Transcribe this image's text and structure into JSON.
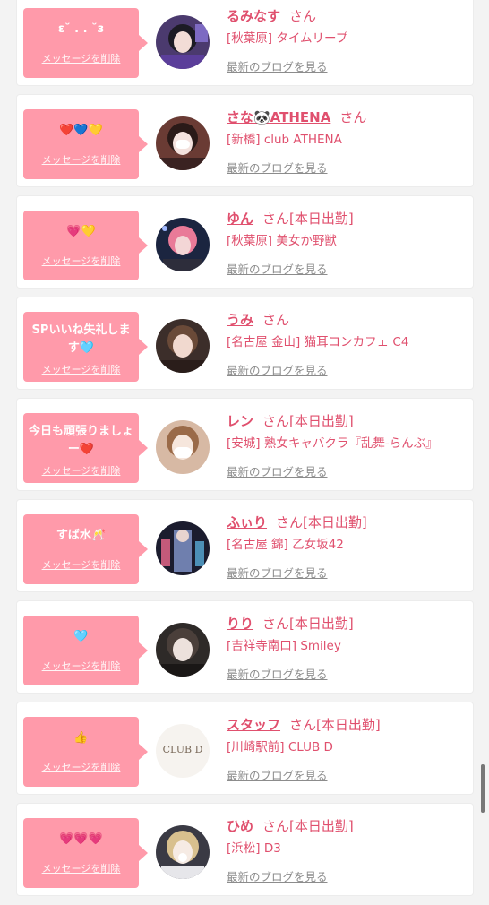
{
  "delete_label": "メッセージを削除",
  "blog_label": "最新のブログを見る",
  "san_label": "さん",
  "messages": [
    {
      "text": "ε˘ . . ˘з",
      "name": "るみなす",
      "suffix": "さん",
      "shop": "[秋葉原] タイムリープ",
      "two_line": false,
      "avatar_icon": "dark-hair-girl-photo"
    },
    {
      "text": "❤️💙💛",
      "name": "さな🐼ATHENA",
      "suffix": "さん",
      "shop": "[新橋] club ATHENA",
      "two_line": false,
      "avatar_icon": "costume-girl-photo"
    },
    {
      "text": "💗💛",
      "name": "ゆん",
      "suffix": "さん[本日出勤]",
      "shop": "[秋葉原] 美女か野獣",
      "two_line": false,
      "avatar_icon": "pink-hair-girl-photo"
    },
    {
      "text": "SPいいね失礼します🩵",
      "name": "うみ",
      "suffix": "さん",
      "shop": "[名古屋 金山] 猫耳コンカフェ C4",
      "two_line": true,
      "avatar_icon": "brown-hair-girl-photo"
    },
    {
      "text": "今日も頑張りましょー❤️",
      "name": "レン",
      "suffix": "さん[本日出勤]",
      "shop": "[安城] 熟女キャバクラ『乱舞-らんぶ』",
      "two_line": true,
      "avatar_icon": "masked-girl-photo"
    },
    {
      "text": "すば水🥂",
      "name": "ふぃり",
      "suffix": "さん[本日出勤]",
      "shop": "[名古屋 錦] 乙女坂42",
      "two_line": false,
      "avatar_icon": "kimono-girl-photo"
    },
    {
      "text": "🩵",
      "name": "りり",
      "suffix": "さん[本日出勤]",
      "shop": "[吉祥寺南口] Smiley",
      "two_line": false,
      "avatar_icon": "long-hair-girl-photo"
    },
    {
      "text": "👍",
      "name": "スタッフ",
      "suffix": "さん[本日出勤]",
      "shop": "[川崎駅前] CLUB D",
      "two_line": false,
      "avatar_icon": "club-d-logo"
    },
    {
      "text": "💗💗💗",
      "name": "ひめ",
      "suffix": "さん[本日出勤]",
      "shop": "[浜松] D3",
      "two_line": false,
      "avatar_icon": "blonde-girl-photo"
    }
  ],
  "logo_text": "CLUB D",
  "colors": {
    "bubble": "#ff9aaa",
    "name": "#e0506e",
    "link": "#8c8c8c"
  }
}
